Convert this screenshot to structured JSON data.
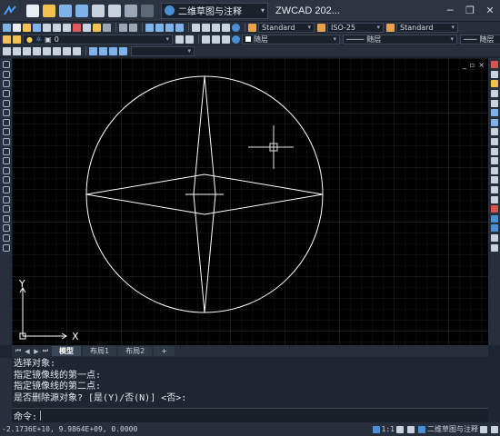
{
  "titlebar": {
    "workspace": "二维草图与注释",
    "app_title": "ZWCAD 202..."
  },
  "toolbar2": {
    "text_style": "Standard",
    "dim_style": "ISO-25",
    "table_style": "Standard"
  },
  "toolbar3": {
    "layer": "0",
    "color": "随层",
    "linetype": "随层",
    "lineweight": "随层"
  },
  "canvas": {
    "ucs_y": "Y",
    "ucs_x": "X",
    "viewport_controls": [
      "_",
      "▫",
      "×"
    ]
  },
  "tabs": [
    "模型",
    "布局1",
    "布局2",
    "+"
  ],
  "command_history": [
    "选择对象:",
    "指定镜像线的第一点:",
    "指定镜像线的第二点:",
    "是否删除源对象? [是(Y)/否(N)] <否>:"
  ],
  "command_prompt": "命令:",
  "statusbar": {
    "coordinates": "-2.1736E+10, 9.9864E+09, 0.0000",
    "scale": "1:1",
    "workspace": "二维草图与注释"
  },
  "colors": {
    "canvas": "#000000",
    "chrome": "#262f3b",
    "entity": "#ffffff"
  }
}
